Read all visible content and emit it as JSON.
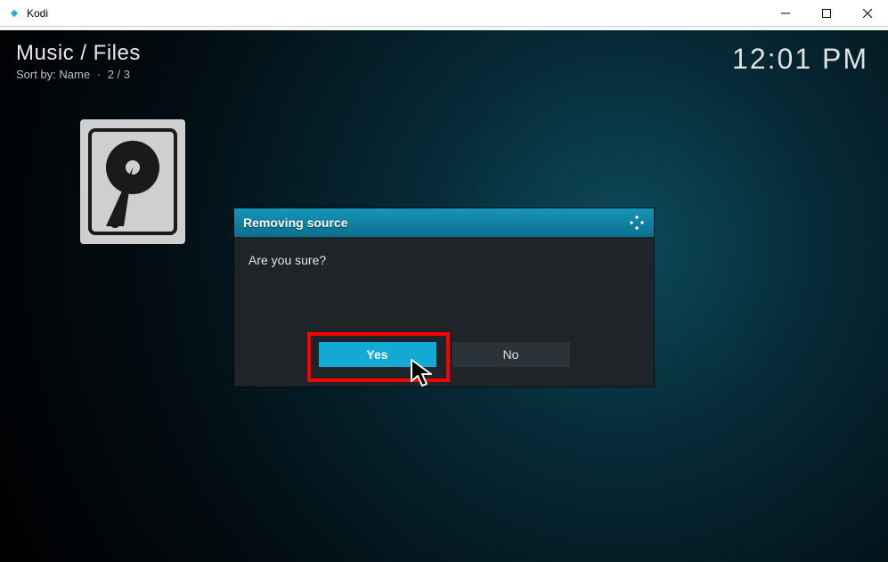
{
  "window": {
    "app_name": "Kodi"
  },
  "header": {
    "breadcrumb": "Music / Files",
    "sort_label": "Sort by: Name",
    "counter": "2 / 3"
  },
  "clock": "12:01 PM",
  "dialog": {
    "title": "Removing source",
    "message": "Are you sure?",
    "yes_label": "Yes",
    "no_label": "No"
  }
}
